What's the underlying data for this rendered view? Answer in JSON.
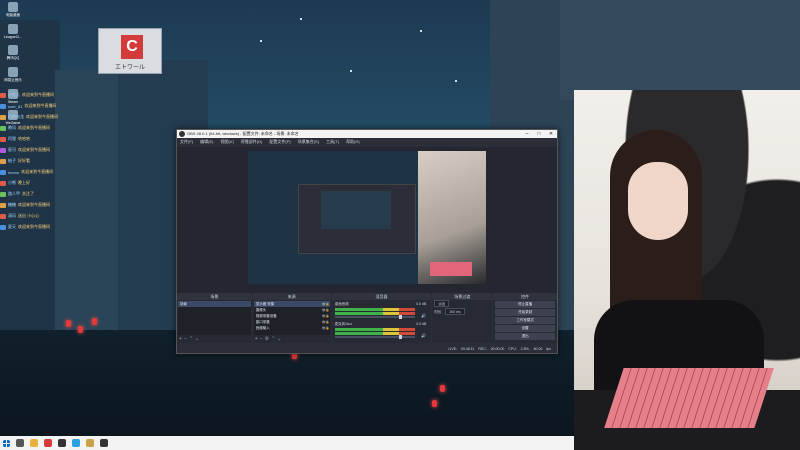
{
  "desktop": {
    "sign_text": "エトワール",
    "icons": [
      {
        "label": "电脑桌面"
      },
      {
        "label": "LeagueCl..."
      },
      {
        "label": "腾讯QQ"
      },
      {
        "label": "网易云音乐"
      },
      {
        "label": "Steam"
      },
      {
        "label": "WeGame"
      }
    ],
    "chat": [
      {
        "user": "小鱼儿",
        "msg": "欢迎来到今直播间",
        "badge": "#e05a4a"
      },
      {
        "user": "user_81",
        "msg": "欢迎来到今直播间",
        "badge": "#4a8fe0"
      },
      {
        "user": "白桃乌龙",
        "msg": "欢迎来到今直播间",
        "badge": "#e0a04a"
      },
      {
        "user": "晚风",
        "msg": "欢迎来到今直播间",
        "badge": "#6ac05a"
      },
      {
        "user": "阿狸",
        "msg": "哈哈哈",
        "badge": "#e05a4a"
      },
      {
        "user": "星河",
        "msg": "欢迎来到今直播间",
        "badge": "#b05ae0"
      },
      {
        "user": "柚子",
        "msg": "好好看",
        "badge": "#e0a04a"
      },
      {
        "user": "momo",
        "msg": "欢迎来到今直播间",
        "badge": "#4a8fe0"
      },
      {
        "user": "小熊",
        "msg": "晚上好",
        "badge": "#e05a4a"
      },
      {
        "user": "路人甲",
        "msg": "关注了",
        "badge": "#6ac05a"
      },
      {
        "user": "糖糖",
        "msg": "欢迎来到今直播间",
        "badge": "#e0a04a"
      },
      {
        "user": "清风",
        "msg": "送出 小心心",
        "badge": "#e05a4a"
      },
      {
        "user": "夏天",
        "msg": "欢迎来到今直播间",
        "badge": "#4a8fe0"
      }
    ]
  },
  "obs": {
    "title": "OBS 28.0.1 (64-bit, windows) - 配置文件: 未命名 - 场景: 未命名",
    "menu": [
      "文件(F)",
      "编辑(E)",
      "视图(V)",
      "停靠部件(D)",
      "配置文件(P)",
      "场景集合(S)",
      "工具(T)",
      "帮助(H)"
    ],
    "docks": {
      "scenes": {
        "title": "场景",
        "items": [
          "场景"
        ]
      },
      "sources": {
        "title": "来源",
        "items": [
          "显示器 采集",
          "摄像头",
          "视频采集设备",
          "窗口采集",
          "音频输入"
        ]
      },
      "mixer": {
        "title": "混音器",
        "channels": [
          {
            "name": "桌面音频",
            "db": "0.0 dB",
            "level": 0.8
          },
          {
            "name": "麦克风/Aux",
            "db": "0.0 dB",
            "level": 0.8
          }
        ]
      },
      "transitions": {
        "title": "场景过渡",
        "type": "淡出",
        "duration_label": "时长",
        "duration": "300 ms"
      },
      "controls": {
        "title": "控件",
        "buttons": [
          "停止直播",
          "开始录制",
          "工作室模式",
          "设置",
          "退出"
        ]
      }
    },
    "status": {
      "live": "LIVE: 00:48:11",
      "rec": "REC: 00:00:00",
      "cpu": "CPU: 2.8%, 60.00 fps"
    }
  },
  "taskbar": {
    "icons": [
      {
        "name": "start-icon",
        "color": "#0a69c7"
      },
      {
        "name": "search-icon",
        "color": "#555555"
      },
      {
        "name": "folder-icon",
        "color": "#e8b23a"
      },
      {
        "name": "browser-icon",
        "color": "#d33a3a"
      },
      {
        "name": "obs-icon",
        "color": "#333333"
      },
      {
        "name": "chat-icon",
        "color": "#2aa0e0"
      },
      {
        "name": "game-icon",
        "color": "#c9a24a"
      },
      {
        "name": "app-icon",
        "color": "#333333"
      }
    ]
  }
}
